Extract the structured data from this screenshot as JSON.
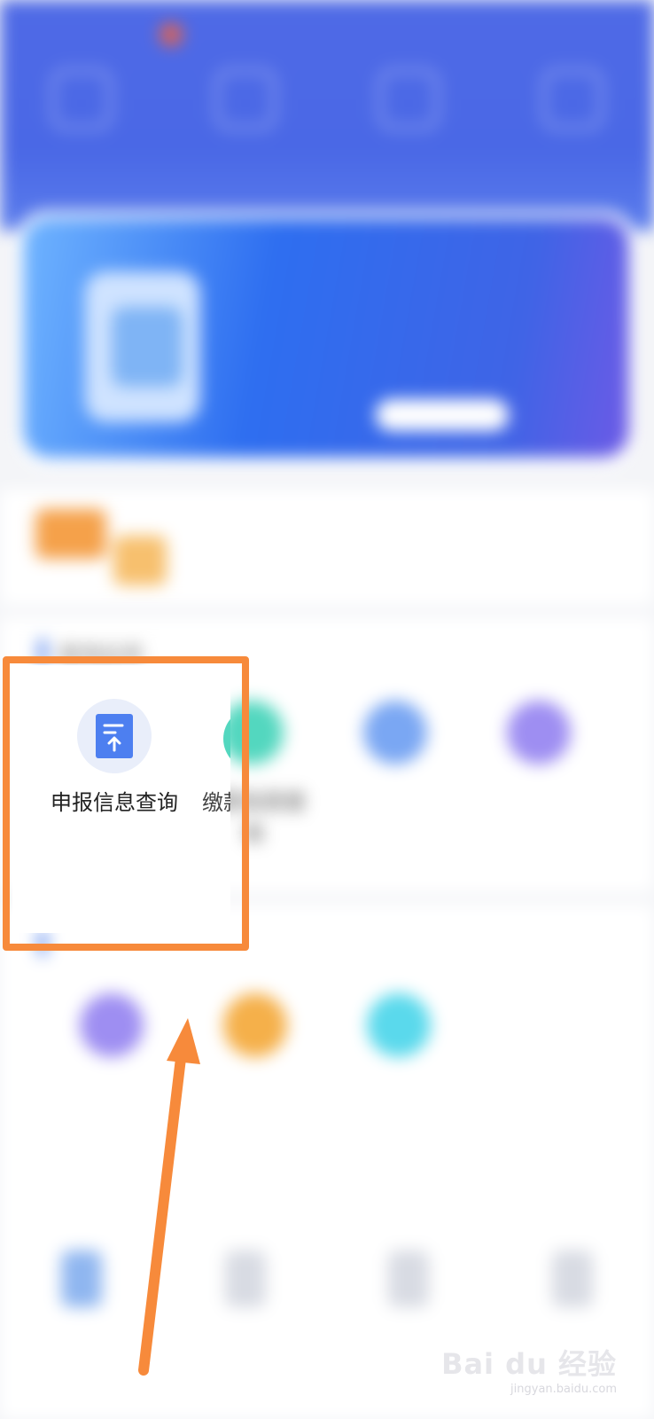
{
  "status_bar": {
    "left": "",
    "right": ""
  },
  "top_nav": [
    {
      "label": "",
      "icon": "grid-icon"
    },
    {
      "label": "",
      "icon": "declare-icon"
    },
    {
      "label": "",
      "icon": "service-icon"
    },
    {
      "label": "",
      "icon": "profile-icon"
    }
  ],
  "banner": {
    "line1": "",
    "line2": "",
    "button": ""
  },
  "notice": {
    "text": ""
  },
  "query_section": {
    "title": "查询业务",
    "items": [
      {
        "label": "申报信息查询",
        "icon": "declare-document-icon",
        "color": "#4d7ff0"
      },
      {
        "label": "缴款信息查询",
        "icon": "payment-icon",
        "color": "#53d7bf"
      },
      {
        "label": "",
        "icon": "query-icon",
        "color": "#7aa7f3"
      },
      {
        "label": "",
        "icon": "record-icon",
        "color": "#9e8ef2"
      }
    ],
    "partial_visible_label": "缴款信"
  },
  "second_section": {
    "title": "",
    "items": [
      {
        "label": "",
        "icon": "purple-icon",
        "color": "#9e8ef2"
      },
      {
        "label": "",
        "icon": "orange-icon",
        "color": "#f5b04a"
      },
      {
        "label": "",
        "icon": "cyan-icon",
        "color": "#5ad9ec"
      }
    ]
  },
  "bottom_nav": [
    {
      "label": "",
      "icon": "home-icon",
      "active": true
    },
    {
      "label": "",
      "icon": "office-icon",
      "active": false
    },
    {
      "label": "",
      "icon": "message-icon",
      "active": false
    },
    {
      "label": "",
      "icon": "me-icon",
      "active": false
    }
  ],
  "annotation": {
    "color": "#f78a3b"
  },
  "watermark": {
    "main": "Bai du 经验",
    "sub": "jingyan.baidu.com"
  }
}
